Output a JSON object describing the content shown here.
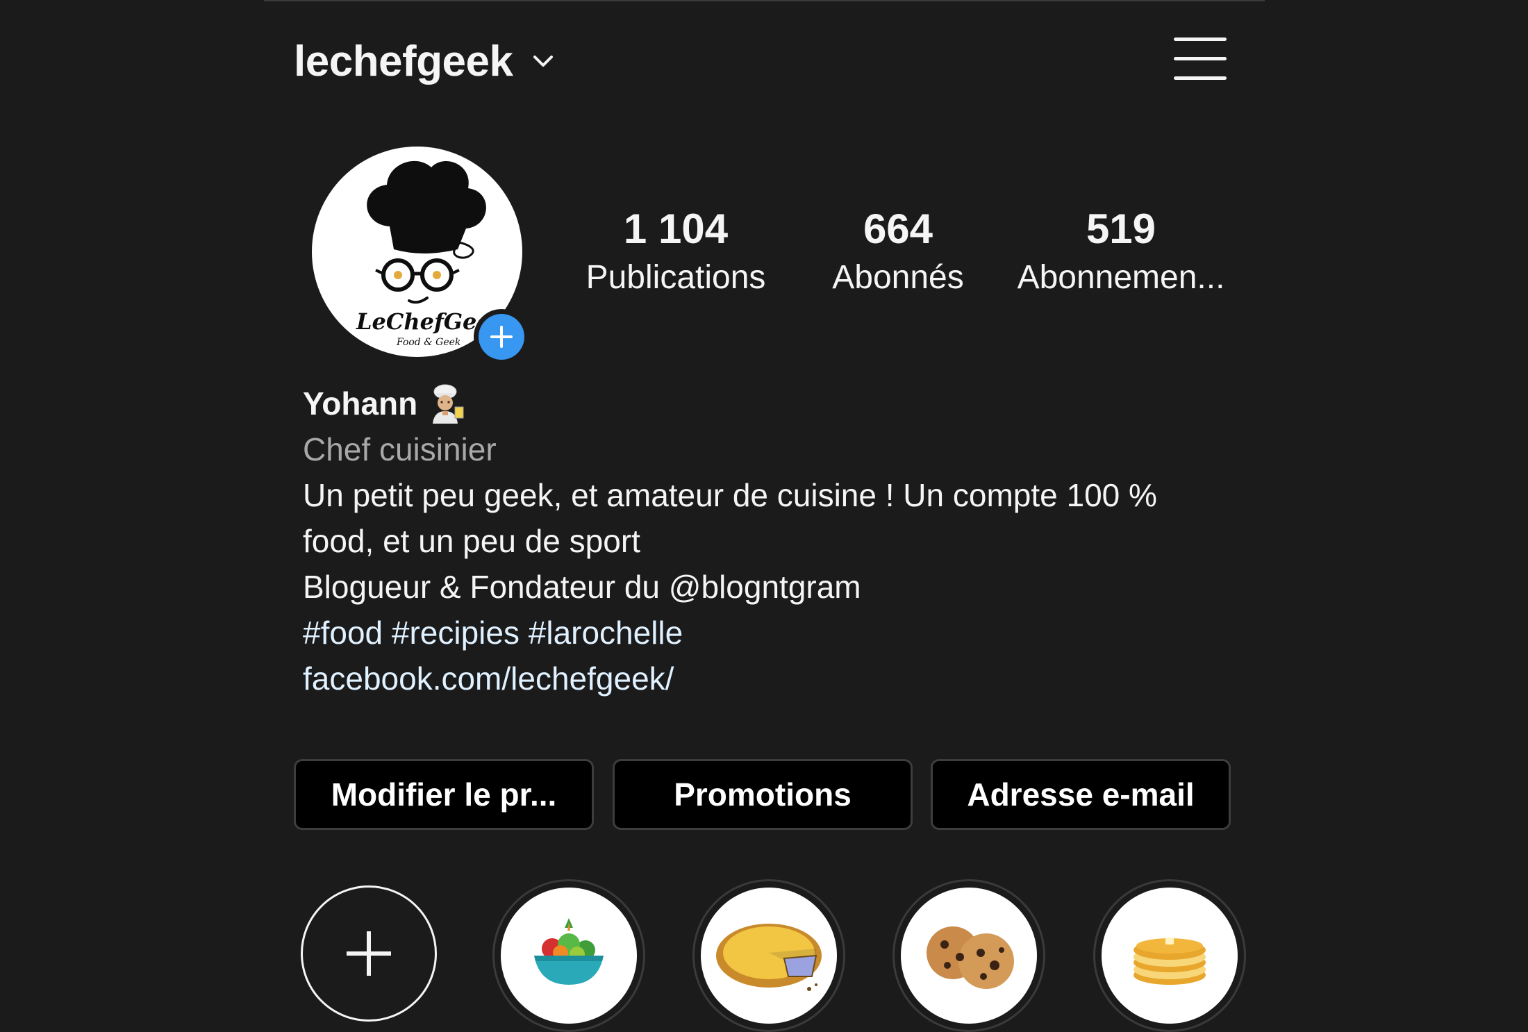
{
  "header": {
    "username": "lechefgeek"
  },
  "profile": {
    "avatar_text": "LeChefGeek",
    "avatar_subtext": "Food & Geek",
    "stats": [
      {
        "value": "1 104",
        "label": "Publications"
      },
      {
        "value": "664",
        "label": "Abonnés"
      },
      {
        "value": "519",
        "label": "Abonnemen..."
      }
    ],
    "name": "Yohann",
    "category": "Chef cuisinier",
    "bio_line1": "Un petit peu geek, et amateur de cuisine ! Un compte 100 %",
    "bio_line2": "food, et un peu de sport",
    "bio_line3": "Blogueur & Fondateur du @blogntgram",
    "hashtags": "#food #recipies #larochelle",
    "website": "facebook.com/lechefgeek/"
  },
  "actions": {
    "edit_label": "Modifier le pr...",
    "promotions_label": "Promotions",
    "email_label": "Adresse e-mail"
  },
  "highlights": [
    {
      "icon": "new-highlight-icon"
    },
    {
      "icon": "salad-bowl-icon"
    },
    {
      "icon": "pie-icon"
    },
    {
      "icon": "cookies-icon"
    },
    {
      "icon": "pancakes-icon"
    }
  ],
  "colors": {
    "background": "#1b1b1c",
    "accent": "#3897f0",
    "link": "#e0f1ff",
    "muted": "#a8a8a8"
  }
}
